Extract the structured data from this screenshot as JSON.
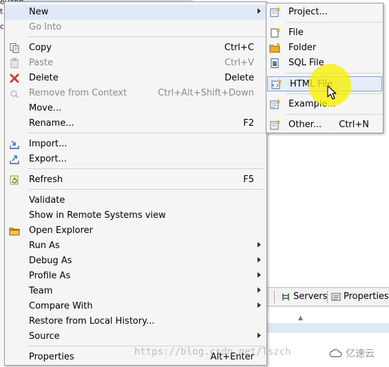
{
  "background": {
    "left_fragments": [
      "euabb",
      "t",
      "ct"
    ],
    "tabs": [
      {
        "label": "Servers",
        "icon": "servers-icon"
      },
      {
        "label": "Properties",
        "icon": "properties-icon"
      }
    ]
  },
  "context_menu": {
    "items": [
      {
        "label": "New",
        "accel": "",
        "submenu": true,
        "highlighted": true,
        "icon": ""
      },
      {
        "label": "Go Into",
        "accel": "",
        "disabled": true,
        "icon": ""
      },
      {
        "label": "Copy",
        "accel": "Ctrl+C",
        "icon": "copy-icon"
      },
      {
        "label": "Paste",
        "accel": "Ctrl+V",
        "disabled": true,
        "icon": "paste-icon"
      },
      {
        "label": "Delete",
        "accel": "Delete",
        "icon": "delete-icon"
      },
      {
        "label": "Remove from Context",
        "accel": "Ctrl+Alt+Shift+Down",
        "disabled": true,
        "icon": "remove-context-icon"
      },
      {
        "label": "Move...",
        "accel": "",
        "icon": ""
      },
      {
        "label": "Rename...",
        "accel": "F2",
        "icon": ""
      },
      {
        "label": "Import...",
        "accel": "",
        "icon": "import-icon"
      },
      {
        "label": "Export...",
        "accel": "",
        "icon": "export-icon"
      },
      {
        "label": "Refresh",
        "accel": "F5",
        "icon": "refresh-icon"
      },
      {
        "label": "Validate",
        "accel": "",
        "icon": ""
      },
      {
        "label": "Show in Remote Systems view",
        "accel": "",
        "icon": ""
      },
      {
        "label": "Open Explorer",
        "accel": "",
        "icon": "open-explorer-icon"
      },
      {
        "label": "Run As",
        "accel": "",
        "submenu": true,
        "icon": ""
      },
      {
        "label": "Debug As",
        "accel": "",
        "submenu": true,
        "icon": ""
      },
      {
        "label": "Profile As",
        "accel": "",
        "submenu": true,
        "icon": ""
      },
      {
        "label": "Team",
        "accel": "",
        "submenu": true,
        "icon": ""
      },
      {
        "label": "Compare With",
        "accel": "",
        "submenu": true,
        "icon": ""
      },
      {
        "label": "Restore from Local History...",
        "accel": "",
        "icon": ""
      },
      {
        "label": "Source",
        "accel": "",
        "submenu": true,
        "icon": ""
      },
      {
        "label": "Properties",
        "accel": "Alt+Enter",
        "icon": ""
      }
    ]
  },
  "new_submenu": {
    "items": [
      {
        "label": "Project...",
        "accel": "",
        "icon": "new-project-icon"
      },
      {
        "label": "File",
        "accel": "",
        "icon": "new-file-icon"
      },
      {
        "label": "Folder",
        "accel": "",
        "icon": "new-folder-icon"
      },
      {
        "label": "SQL File",
        "accel": "",
        "icon": "sql-file-icon"
      },
      {
        "label": "HTML File",
        "accel": "",
        "icon": "html-file-icon",
        "highlighted": true
      },
      {
        "label": "Example...",
        "accel": "",
        "icon": "example-icon"
      },
      {
        "label": "Other...",
        "accel": "Ctrl+N",
        "icon": "other-wizard-icon"
      }
    ]
  },
  "watermark": {
    "url_text": "https://blog.csdn.net/Tszch",
    "brand_text": "亿速云"
  },
  "colors": {
    "menu_bg": "#f5f5f5",
    "highlight": "#dfe9f7",
    "highlighter_spot": "#faf000",
    "delete_red": "#d83a2e"
  }
}
